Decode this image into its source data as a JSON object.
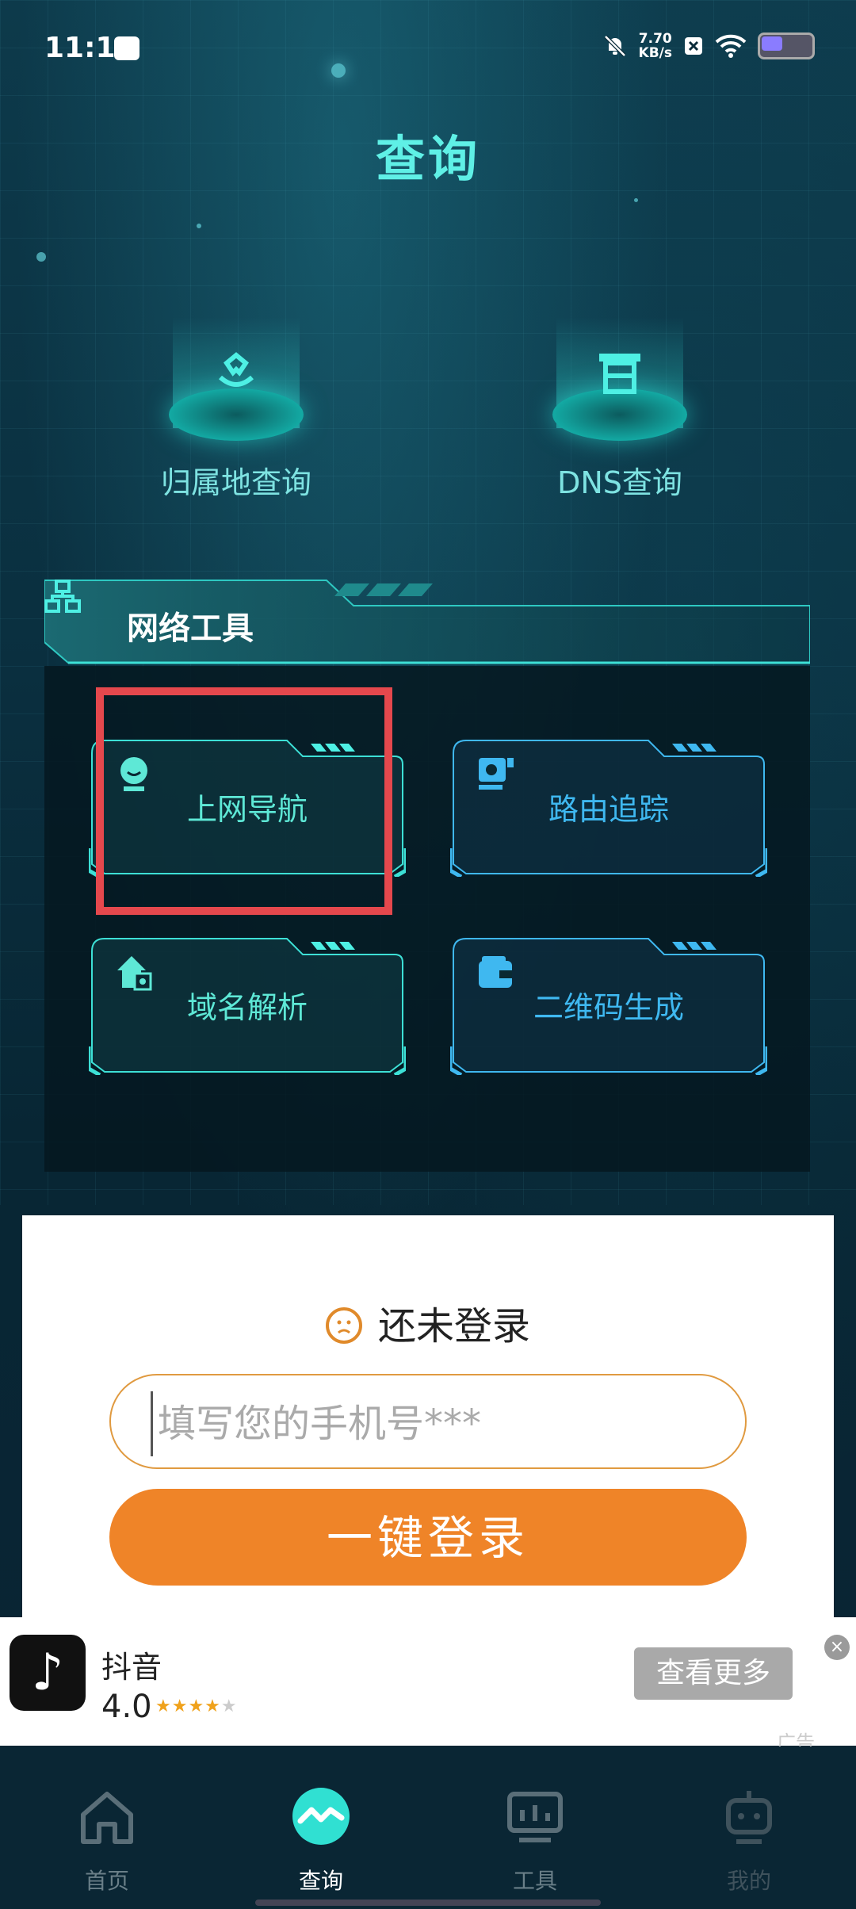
{
  "status_bar": {
    "time": "11:11",
    "net_speed_value": "7.70",
    "net_speed_unit": "KB/s"
  },
  "page_title": "查询",
  "query_items": [
    {
      "label": "归属地查询",
      "icon": "location-flower-icon"
    },
    {
      "label": "DNS查询",
      "icon": "server-icon"
    }
  ],
  "network_tools": {
    "title": "网络工具",
    "icon": "network-topology-icon",
    "items": [
      {
        "label": "上网导航",
        "icon": "smiley-icon",
        "color": "#5ee8d6"
      },
      {
        "label": "路由追踪",
        "icon": "router-trace-icon",
        "color": "#3fb8f0"
      },
      {
        "label": "域名解析",
        "icon": "house-dns-icon",
        "color": "#5ee8d6"
      },
      {
        "label": "二维码生成",
        "icon": "wallet-icon",
        "color": "#3fb8f0"
      }
    ]
  },
  "login": {
    "status": "还未登录",
    "phone_placeholder": "填写您的手机号***",
    "button": "一键登录"
  },
  "ad": {
    "app_name": "抖音",
    "rating": "4.0",
    "stars": 4,
    "action": "查看更多",
    "close": "×",
    "tag": "广告"
  },
  "bottom_nav": [
    {
      "label": "首页",
      "icon": "home-icon",
      "active": false
    },
    {
      "label": "查询",
      "icon": "query-pulse-icon",
      "active": true
    },
    {
      "label": "工具",
      "icon": "monitor-icon",
      "active": false
    },
    {
      "label": "我的",
      "icon": "robot-icon",
      "active": false
    }
  ],
  "colors": {
    "accent": "#5ff0e6",
    "login_button": "#ef8428",
    "highlight_box": "#e5484d"
  }
}
